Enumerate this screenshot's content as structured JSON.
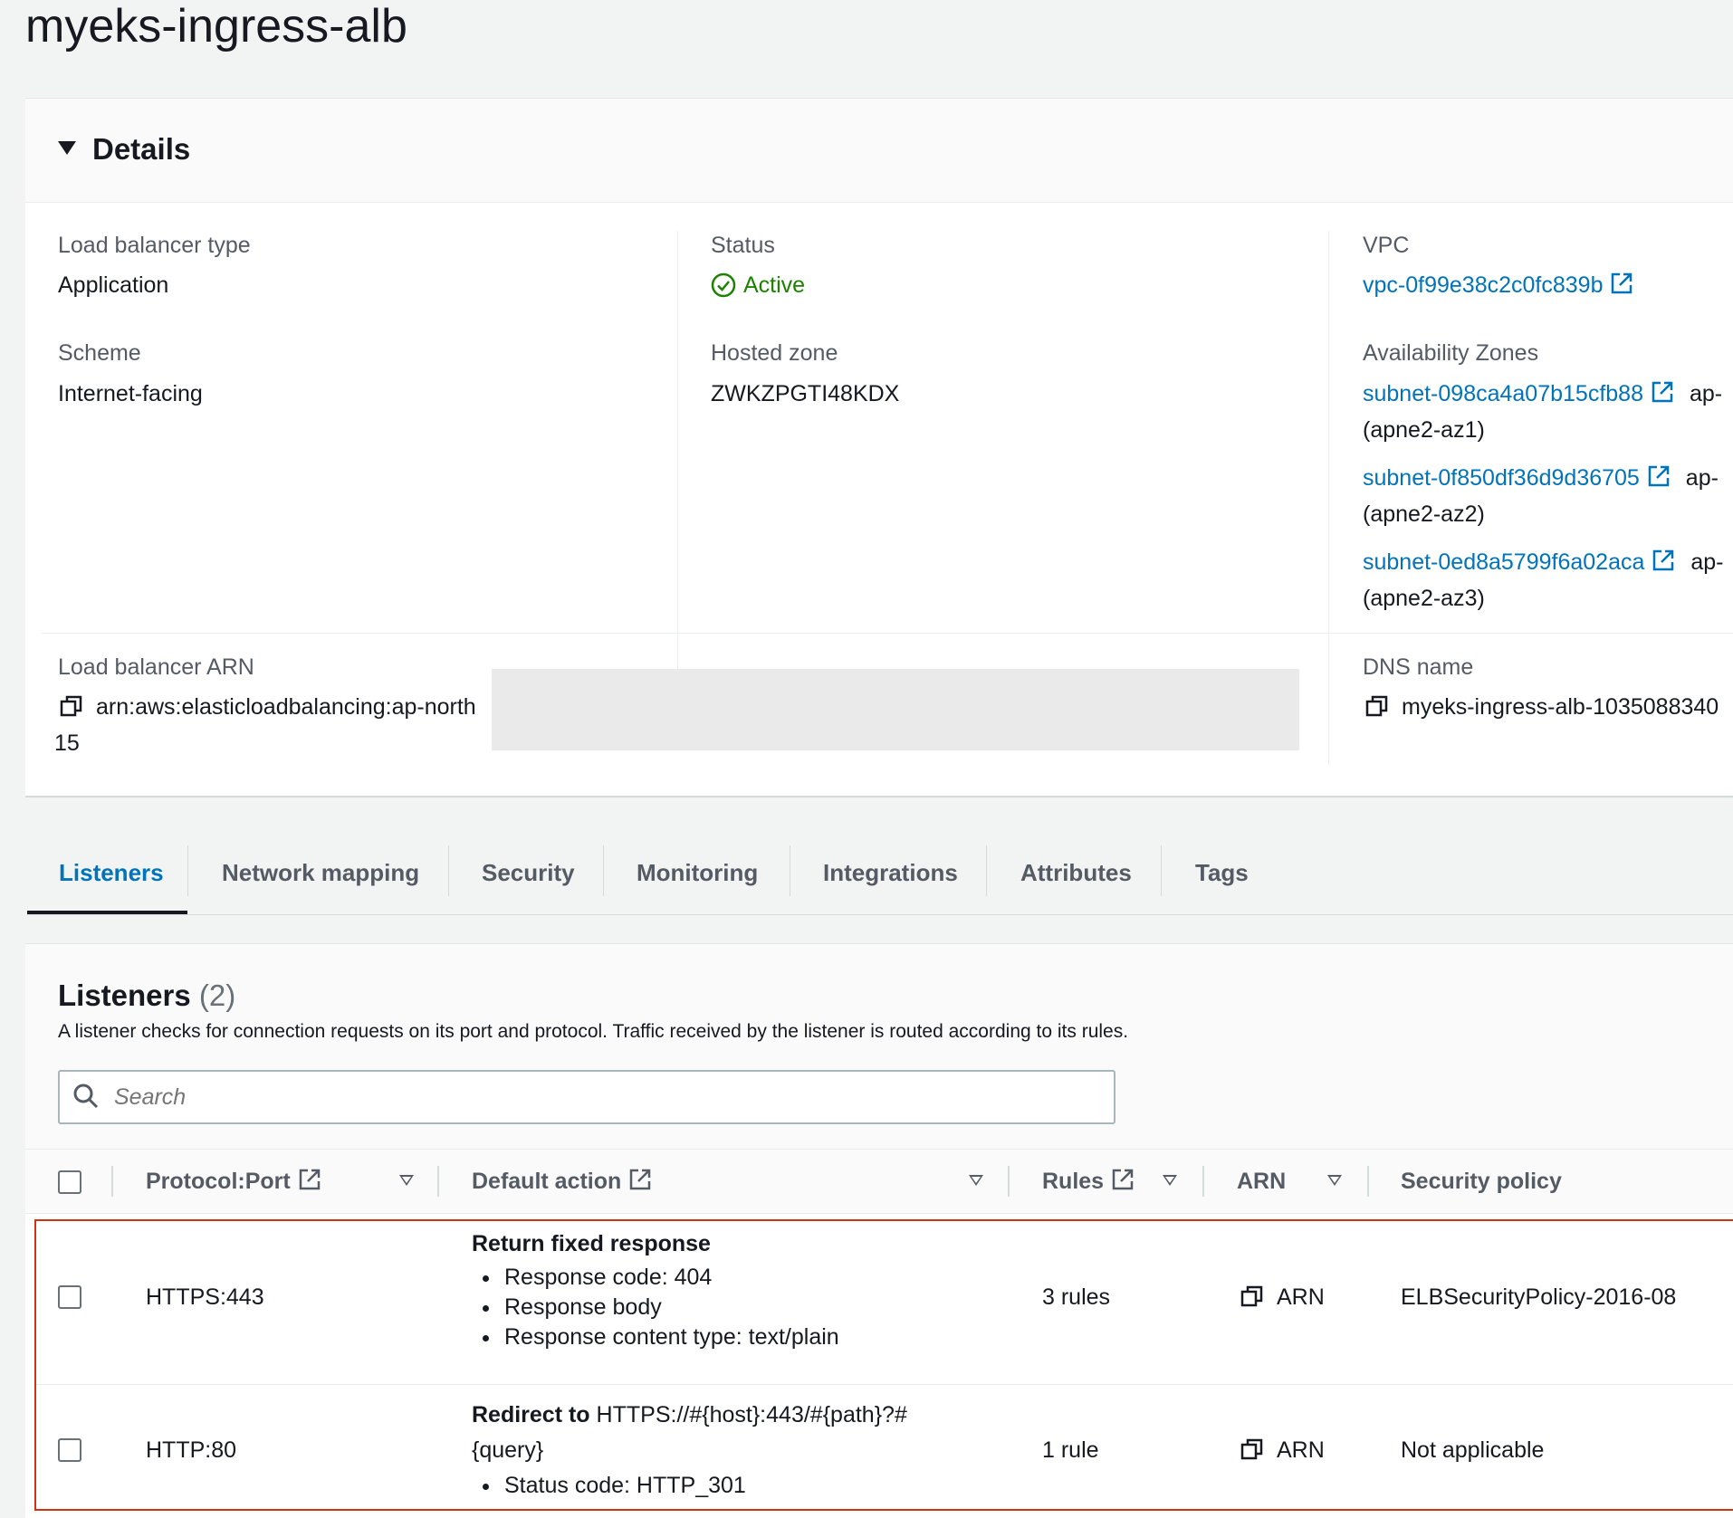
{
  "page": {
    "title": "myeks-ingress-alb"
  },
  "details": {
    "header": "Details",
    "lb_type": {
      "label": "Load balancer type",
      "value": "Application"
    },
    "status": {
      "label": "Status",
      "value": "Active"
    },
    "vpc": {
      "label": "VPC",
      "value": "vpc-0f99e38c2c0fc839b"
    },
    "scheme": {
      "label": "Scheme",
      "value": "Internet-facing"
    },
    "hosted_zone": {
      "label": "Hosted zone",
      "value": "ZWKZPGTI48KDX"
    },
    "availability_zones": {
      "label": "Availability Zones",
      "items": [
        {
          "subnet": "subnet-098ca4a07b15cfb88",
          "suffix": "ap-",
          "zone": "(apne2-az1)"
        },
        {
          "subnet": "subnet-0f850df36d9d36705",
          "suffix": "ap-",
          "zone": "(apne2-az2)"
        },
        {
          "subnet": "subnet-0ed8a5799f6a02aca",
          "suffix": "ap-",
          "zone": "(apne2-az3)"
        }
      ]
    },
    "arn": {
      "label": "Load balancer ARN",
      "value": "arn:aws:elasticloadbalancing:ap-north",
      "cont": "15"
    },
    "dns": {
      "label": "DNS name",
      "value": "myeks-ingress-alb-1035088340"
    }
  },
  "tabs": [
    {
      "label": "Listeners",
      "active": true
    },
    {
      "label": "Network mapping"
    },
    {
      "label": "Security"
    },
    {
      "label": "Monitoring"
    },
    {
      "label": "Integrations"
    },
    {
      "label": "Attributes"
    },
    {
      "label": "Tags"
    }
  ],
  "listeners": {
    "title": "Listeners",
    "count": "(2)",
    "description": "A listener checks for connection requests on its port and protocol. Traffic received by the listener is routed according to its rules.",
    "search_placeholder": "Search",
    "columns": {
      "protocol_port": "Protocol:Port",
      "default_action": "Default action",
      "rules": "Rules",
      "arn": "ARN",
      "security_policy": "Security policy"
    },
    "rows": [
      {
        "protocol_port": "HTTPS:443",
        "action_title": "Return fixed response",
        "action_items": [
          "Response code: 404",
          "Response body",
          "Response content type: text/plain"
        ],
        "rules": "3 rules",
        "arn": "ARN",
        "security_policy": "ELBSecurityPolicy-2016-08"
      },
      {
        "protocol_port": "HTTP:80",
        "action_title": "Redirect to",
        "action_target": "HTTPS://#{host}:443/#{path}?#",
        "action_target_cont": "{query}",
        "action_items": [
          "Status code: HTTP_301"
        ],
        "rules": "1 rule",
        "arn": "ARN",
        "security_policy": "Not applicable"
      }
    ]
  },
  "colors": {
    "link": "#0073bb",
    "success": "#1d8102",
    "highlight": "#d13212"
  }
}
